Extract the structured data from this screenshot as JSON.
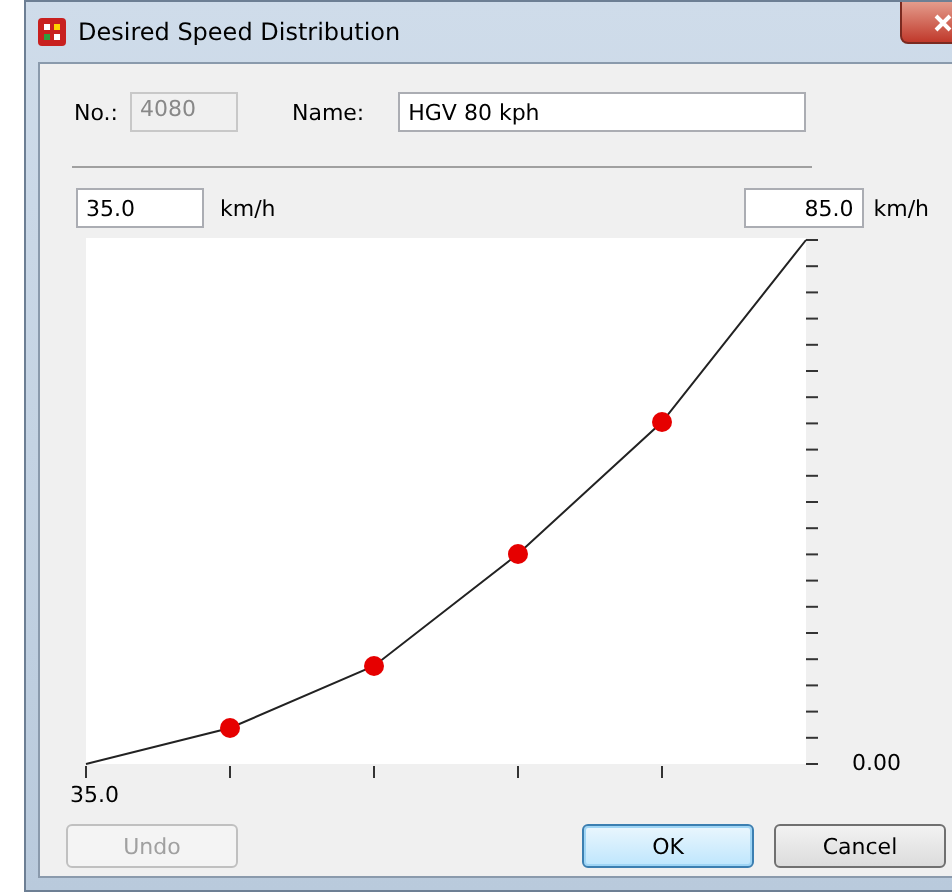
{
  "window": {
    "title": "Desired Speed Distribution"
  },
  "number": {
    "label": "No.:",
    "value": "4080",
    "disabled": true
  },
  "name": {
    "label": "Name:",
    "value": "HGV 80 kph"
  },
  "range": {
    "min": "35.0",
    "min_unit": "km/h",
    "max": "85.0",
    "max_unit": "km/h"
  },
  "axis": {
    "x_start": "35.0",
    "y_start": "0.00"
  },
  "buttons": [
    {
      "label": "Undo",
      "disabled": true,
      "default": false
    },
    {
      "label": "OK",
      "disabled": false,
      "default": true
    },
    {
      "label": "Cancel",
      "disabled": false,
      "default": false
    }
  ]
}
